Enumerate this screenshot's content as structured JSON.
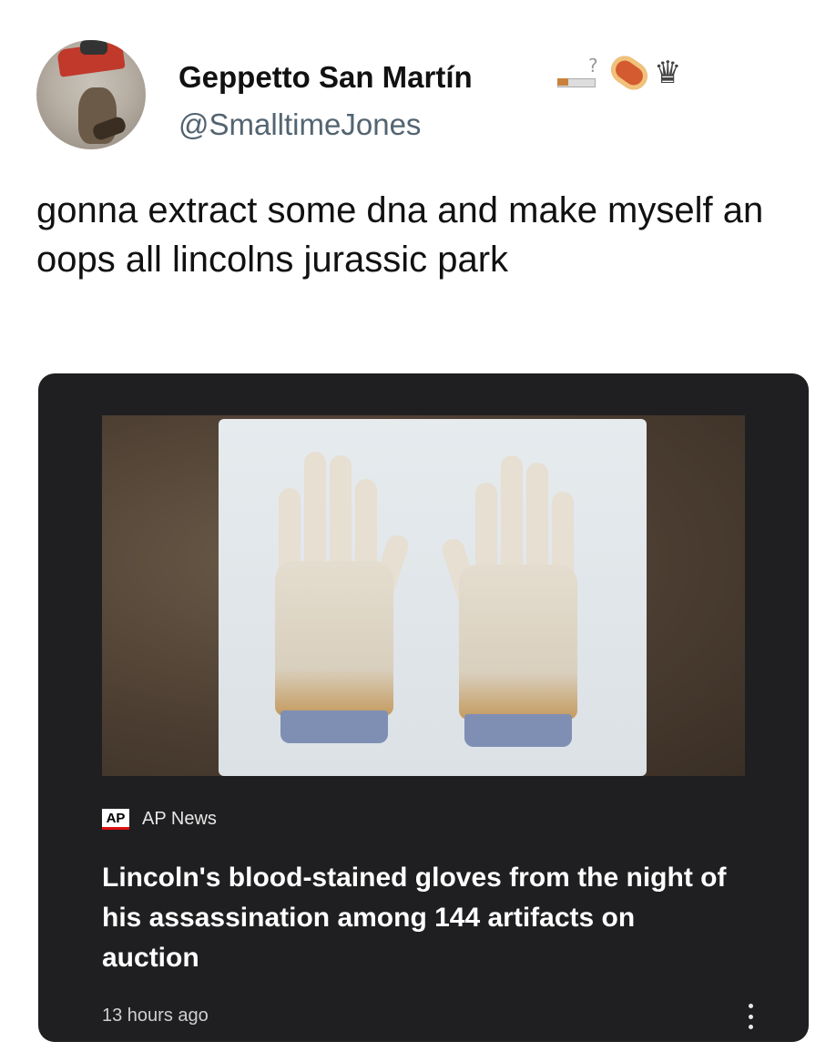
{
  "user": {
    "display_name": "Geppetto San Martín",
    "handle": "@SmalltimeJones",
    "name_emojis": [
      "cigarette-icon",
      "hotdog-icon",
      "crown-icon"
    ]
  },
  "tweet": {
    "text": "gonna extract some dna and make myself an oops all lincolns jurassic park"
  },
  "news_card": {
    "source_logo_text": "AP",
    "source_name": "AP News",
    "headline": "Lincoln's blood-stained gloves from the night of his assassination among 144 artifacts on auction",
    "timestamp": "13 hours ago",
    "colors": {
      "background": "#1f1f21",
      "text": "#ffffff",
      "logo_underline": "#dd1111"
    }
  }
}
